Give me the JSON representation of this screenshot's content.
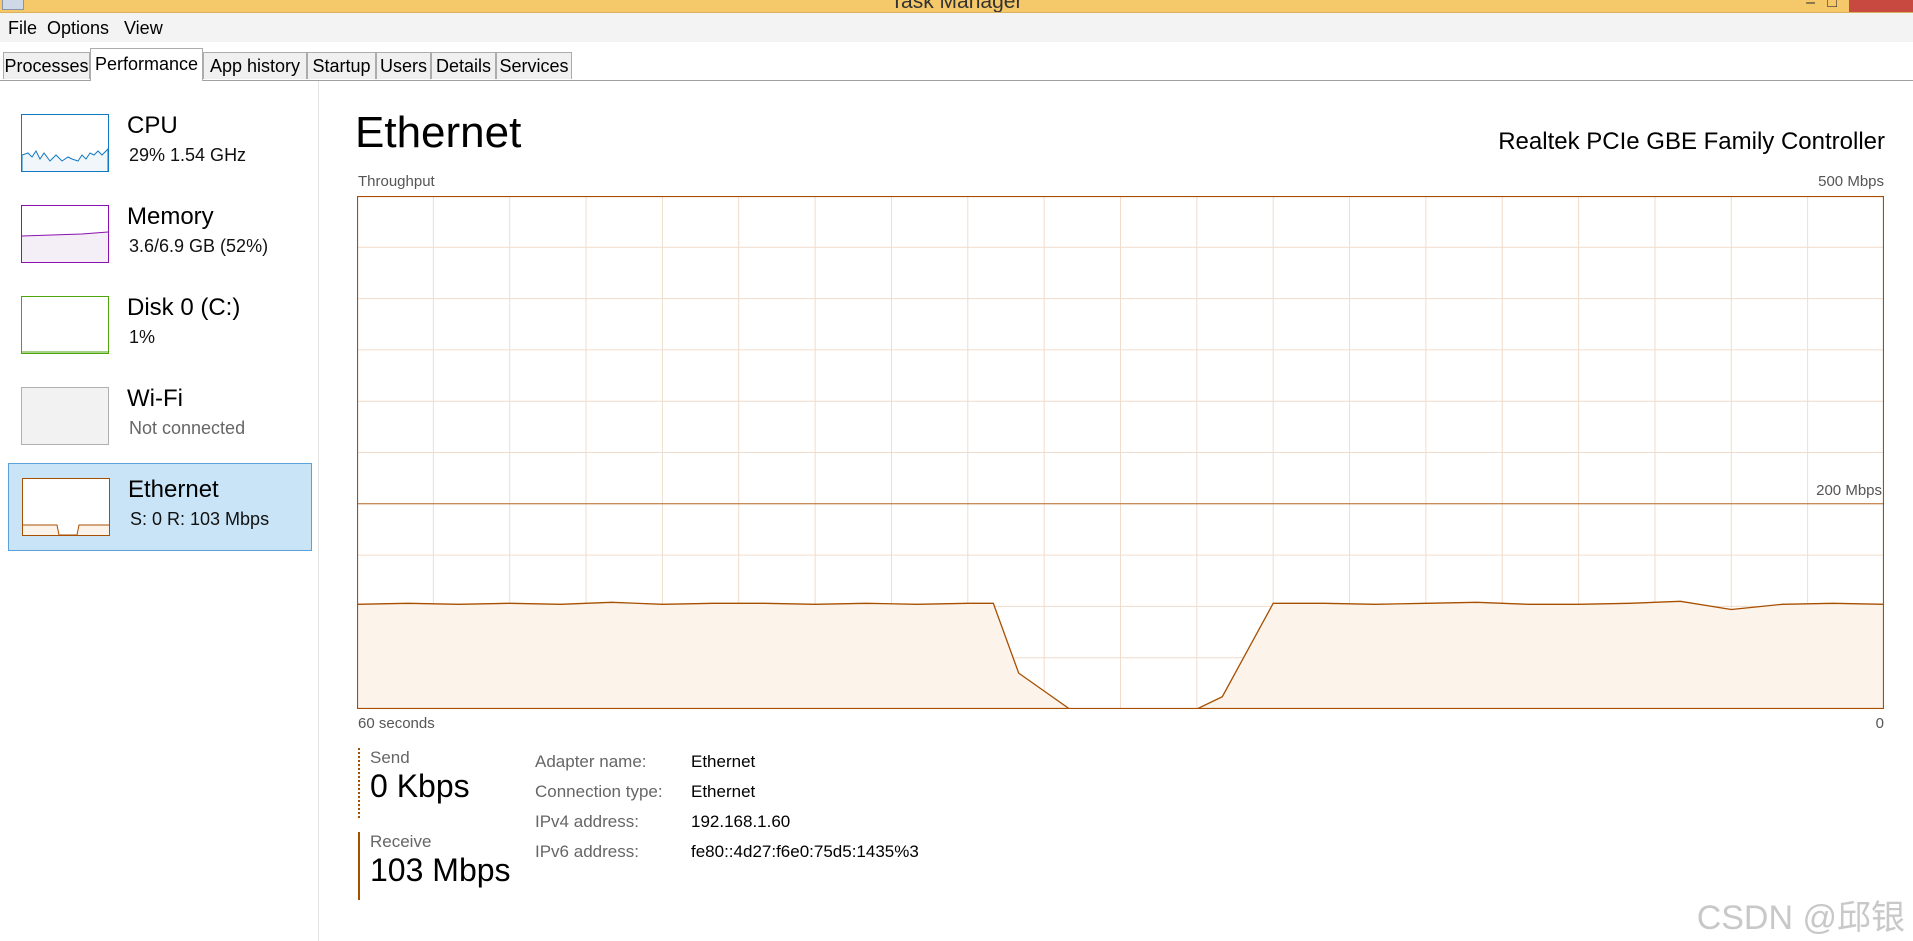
{
  "window": {
    "title": "Task Manager"
  },
  "menu": {
    "items": [
      "File",
      "Options",
      "View"
    ]
  },
  "tabs": [
    "Processes",
    "Performance",
    "App history",
    "Startup",
    "Users",
    "Details",
    "Services"
  ],
  "active_tab": "Performance",
  "sidebar": {
    "items": [
      {
        "name": "CPU",
        "detail": "29%  1.54 GHz",
        "color": "#1179c2"
      },
      {
        "name": "Memory",
        "detail": "3.6/6.9 GB (52%)",
        "color": "#8b12ae"
      },
      {
        "name": "Disk 0 (C:)",
        "detail": "1%",
        "color": "#4da60c"
      },
      {
        "name": "Wi-Fi",
        "detail": "Not connected",
        "color": "#a0a0a0"
      },
      {
        "name": "Ethernet",
        "detail": "S: 0  R: 103 Mbps",
        "color": "#a74f01",
        "selected": true
      }
    ]
  },
  "main": {
    "title": "Ethernet",
    "device": "Realtek PCIe GBE Family Controller",
    "graph": {
      "top_left_label": "Throughput",
      "top_right_label": "500 Mbps",
      "mid_label": "200 Mbps",
      "bottom_left_label": "60 seconds",
      "bottom_right_label": "0",
      "line_color": "#a74f01",
      "fill_color": "#fcf3eb",
      "grid_color": "#f0dccc"
    },
    "send": {
      "label": "Send",
      "value": "0 Kbps"
    },
    "receive": {
      "label": "Receive",
      "value": "103 Mbps"
    },
    "properties": [
      {
        "key": "Adapter name:",
        "value": "Ethernet"
      },
      {
        "key": "Connection type:",
        "value": "Ethernet"
      },
      {
        "key": "IPv4 address:",
        "value": "192.168.1.60"
      },
      {
        "key": "IPv6 address:",
        "value": "fe80::4d27:f6e0:75d5:1435%3"
      }
    ]
  },
  "chart_data": {
    "type": "area",
    "xlabel": "60 seconds",
    "ylabel": "Throughput",
    "ylim": [
      0,
      500
    ],
    "grid": true,
    "reference_line": 200,
    "x": [
      60,
      58,
      56,
      54,
      52,
      50,
      48,
      46,
      44,
      42,
      40,
      38,
      36,
      35,
      34,
      32,
      30,
      28,
      27,
      26,
      24,
      22,
      20,
      18,
      16,
      14,
      12,
      10,
      8,
      6,
      4,
      2,
      0
    ],
    "series": [
      {
        "name": "Receive",
        "values": [
          102,
          103,
          102,
          103,
          102,
          104,
          102,
          103,
          103,
          102,
          103,
          102,
          103,
          103,
          35,
          0,
          0,
          0,
          0,
          12,
          103,
          103,
          102,
          103,
          104,
          102,
          102,
          103,
          105,
          97,
          102,
          103,
          102
        ]
      },
      {
        "name": "Send",
        "values": [
          0,
          0,
          0,
          0,
          0,
          0,
          0,
          0,
          0,
          0,
          0,
          0,
          0,
          0,
          0,
          0,
          0,
          0,
          0,
          0,
          0,
          0,
          0,
          0,
          0,
          0,
          0,
          0,
          0,
          0,
          0,
          0,
          0
        ]
      }
    ]
  },
  "watermark": "CSDN @邱银"
}
